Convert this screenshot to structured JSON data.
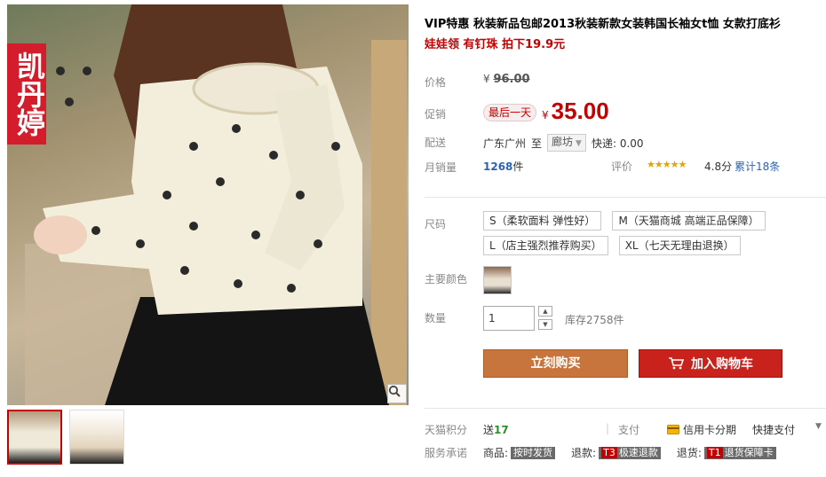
{
  "gallery": {
    "brand_badge": "凯丹婷",
    "thumbnails": [
      "thumb-1",
      "thumb-2"
    ],
    "active_thumbnail": 0
  },
  "product": {
    "title": "VIP特惠 秋装新品包邮2013秋装新款女装韩国长袖女t恤 女款打底衫",
    "subtitle": "娃娃领 有钉珠 拍下19.9元"
  },
  "price": {
    "label": "价格",
    "currency": "¥",
    "original": "96.00",
    "promo_label": "促销",
    "promo_tag": "最后一天",
    "current": "35.00"
  },
  "shipping": {
    "label": "配送",
    "from": "广东广州",
    "to_word": "至",
    "destination": "廊坊",
    "fee": "快递: 0.00"
  },
  "sales": {
    "label": "月销量",
    "count": "1268",
    "unit": "件",
    "rating_label": "评价",
    "stars": "★★★★★",
    "score": "4.8分",
    "reviews": "累计18条"
  },
  "size": {
    "label": "尺码",
    "options": [
      "S（柔软面料 弹性好）",
      "M（天猫商城 高端正品保障）",
      "L（店主强烈推荐购买）",
      "XL（七天无理由退换）"
    ]
  },
  "color": {
    "label": "主要颜色"
  },
  "quantity": {
    "label": "数量",
    "value": "1",
    "stock": "库存2758件"
  },
  "actions": {
    "buy_now": "立刻购买",
    "add_to_cart": "加入购物车"
  },
  "points": {
    "label": "天猫积分",
    "send": "送",
    "value": "17",
    "pay_label": "支付",
    "credit_card": "信用卡分期",
    "quick_pay": "快捷支付"
  },
  "promise": {
    "label": "服务承诺",
    "items": [
      {
        "prefix": "商品:",
        "tag": "按时发货",
        "badge": ""
      },
      {
        "prefix": "退款:",
        "tag": "极速退款",
        "badge": "T3"
      },
      {
        "prefix": "退货:",
        "tag": "退货保障卡",
        "badge": "T1"
      }
    ]
  },
  "colors": {
    "accent": "#c40000",
    "buy_button": "#c8753d",
    "cart_button": "#c9211c",
    "link": "#2a63b3",
    "star": "#e8a200"
  }
}
